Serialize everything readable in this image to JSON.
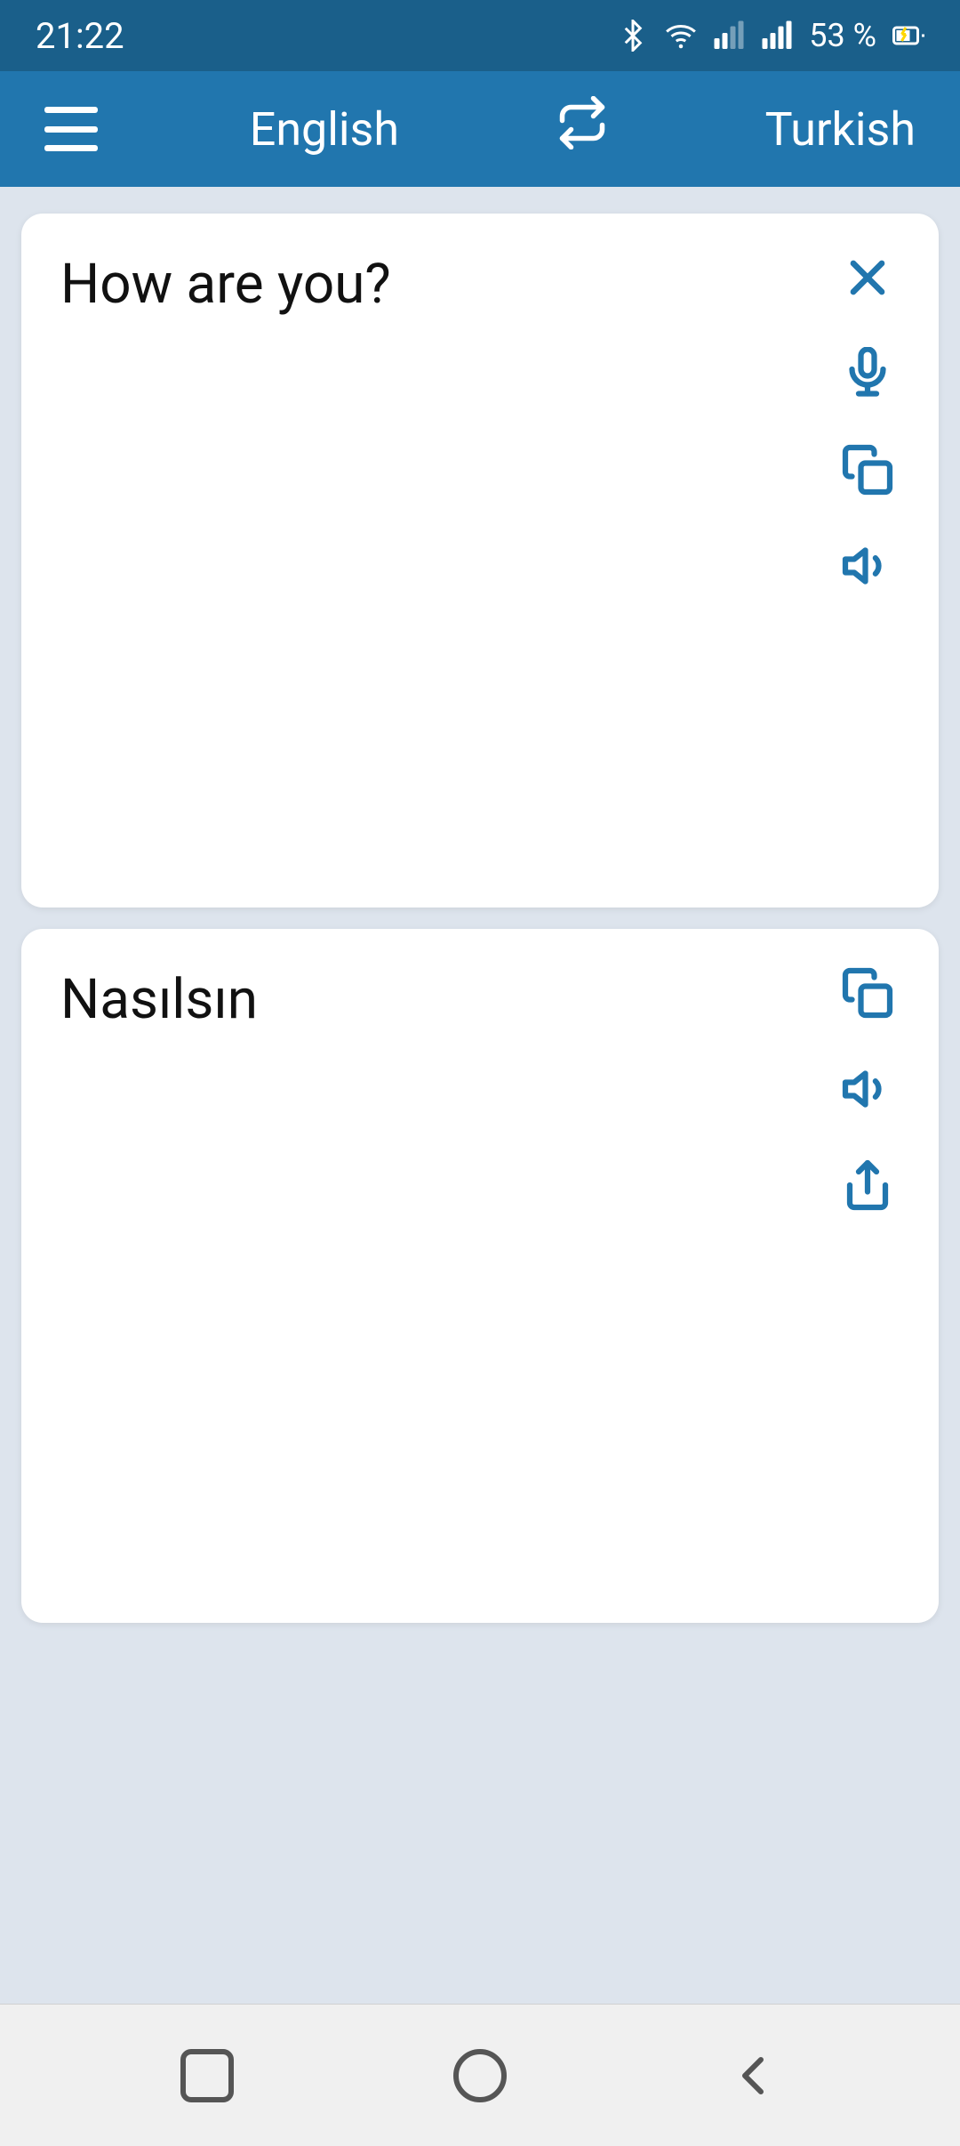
{
  "status_bar": {
    "time": "21:22",
    "battery": "53 %"
  },
  "toolbar": {
    "menu_label": "menu",
    "source_lang": "English",
    "swap_label": "swap languages",
    "target_lang": "Turkish"
  },
  "source_card": {
    "text": "How are you?",
    "clear_label": "clear",
    "mic_label": "microphone",
    "copy_label": "copy",
    "speak_label": "speak"
  },
  "translation_card": {
    "text": "Nasılsın",
    "copy_label": "copy",
    "speak_label": "speak",
    "share_label": "share"
  },
  "bottom_nav": {
    "recent_label": "recent",
    "home_label": "home",
    "back_label": "back"
  }
}
